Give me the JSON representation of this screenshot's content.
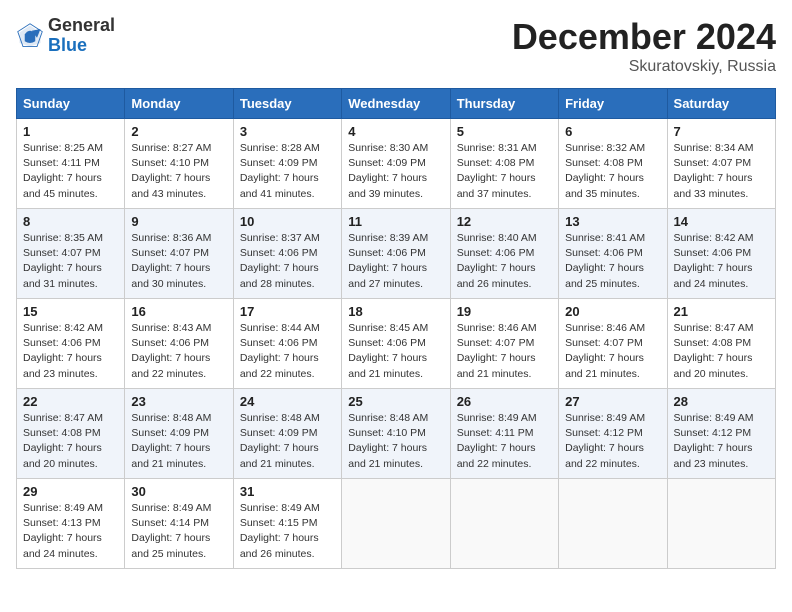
{
  "header": {
    "logo": {
      "line1": "General",
      "line2": "Blue"
    },
    "title": "December 2024",
    "subtitle": "Skuratovskiy, Russia"
  },
  "weekdays": [
    "Sunday",
    "Monday",
    "Tuesday",
    "Wednesday",
    "Thursday",
    "Friday",
    "Saturday"
  ],
  "weeks": [
    [
      {
        "day": "1",
        "detail": "Sunrise: 8:25 AM\nSunset: 4:11 PM\nDaylight: 7 hours\nand 45 minutes."
      },
      {
        "day": "2",
        "detail": "Sunrise: 8:27 AM\nSunset: 4:10 PM\nDaylight: 7 hours\nand 43 minutes."
      },
      {
        "day": "3",
        "detail": "Sunrise: 8:28 AM\nSunset: 4:09 PM\nDaylight: 7 hours\nand 41 minutes."
      },
      {
        "day": "4",
        "detail": "Sunrise: 8:30 AM\nSunset: 4:09 PM\nDaylight: 7 hours\nand 39 minutes."
      },
      {
        "day": "5",
        "detail": "Sunrise: 8:31 AM\nSunset: 4:08 PM\nDaylight: 7 hours\nand 37 minutes."
      },
      {
        "day": "6",
        "detail": "Sunrise: 8:32 AM\nSunset: 4:08 PM\nDaylight: 7 hours\nand 35 minutes."
      },
      {
        "day": "7",
        "detail": "Sunrise: 8:34 AM\nSunset: 4:07 PM\nDaylight: 7 hours\nand 33 minutes."
      }
    ],
    [
      {
        "day": "8",
        "detail": "Sunrise: 8:35 AM\nSunset: 4:07 PM\nDaylight: 7 hours\nand 31 minutes."
      },
      {
        "day": "9",
        "detail": "Sunrise: 8:36 AM\nSunset: 4:07 PM\nDaylight: 7 hours\nand 30 minutes."
      },
      {
        "day": "10",
        "detail": "Sunrise: 8:37 AM\nSunset: 4:06 PM\nDaylight: 7 hours\nand 28 minutes."
      },
      {
        "day": "11",
        "detail": "Sunrise: 8:39 AM\nSunset: 4:06 PM\nDaylight: 7 hours\nand 27 minutes."
      },
      {
        "day": "12",
        "detail": "Sunrise: 8:40 AM\nSunset: 4:06 PM\nDaylight: 7 hours\nand 26 minutes."
      },
      {
        "day": "13",
        "detail": "Sunrise: 8:41 AM\nSunset: 4:06 PM\nDaylight: 7 hours\nand 25 minutes."
      },
      {
        "day": "14",
        "detail": "Sunrise: 8:42 AM\nSunset: 4:06 PM\nDaylight: 7 hours\nand 24 minutes."
      }
    ],
    [
      {
        "day": "15",
        "detail": "Sunrise: 8:42 AM\nSunset: 4:06 PM\nDaylight: 7 hours\nand 23 minutes."
      },
      {
        "day": "16",
        "detail": "Sunrise: 8:43 AM\nSunset: 4:06 PM\nDaylight: 7 hours\nand 22 minutes."
      },
      {
        "day": "17",
        "detail": "Sunrise: 8:44 AM\nSunset: 4:06 PM\nDaylight: 7 hours\nand 22 minutes."
      },
      {
        "day": "18",
        "detail": "Sunrise: 8:45 AM\nSunset: 4:06 PM\nDaylight: 7 hours\nand 21 minutes."
      },
      {
        "day": "19",
        "detail": "Sunrise: 8:46 AM\nSunset: 4:07 PM\nDaylight: 7 hours\nand 21 minutes."
      },
      {
        "day": "20",
        "detail": "Sunrise: 8:46 AM\nSunset: 4:07 PM\nDaylight: 7 hours\nand 21 minutes."
      },
      {
        "day": "21",
        "detail": "Sunrise: 8:47 AM\nSunset: 4:08 PM\nDaylight: 7 hours\nand 20 minutes."
      }
    ],
    [
      {
        "day": "22",
        "detail": "Sunrise: 8:47 AM\nSunset: 4:08 PM\nDaylight: 7 hours\nand 20 minutes."
      },
      {
        "day": "23",
        "detail": "Sunrise: 8:48 AM\nSunset: 4:09 PM\nDaylight: 7 hours\nand 21 minutes."
      },
      {
        "day": "24",
        "detail": "Sunrise: 8:48 AM\nSunset: 4:09 PM\nDaylight: 7 hours\nand 21 minutes."
      },
      {
        "day": "25",
        "detail": "Sunrise: 8:48 AM\nSunset: 4:10 PM\nDaylight: 7 hours\nand 21 minutes."
      },
      {
        "day": "26",
        "detail": "Sunrise: 8:49 AM\nSunset: 4:11 PM\nDaylight: 7 hours\nand 22 minutes."
      },
      {
        "day": "27",
        "detail": "Sunrise: 8:49 AM\nSunset: 4:12 PM\nDaylight: 7 hours\nand 22 minutes."
      },
      {
        "day": "28",
        "detail": "Sunrise: 8:49 AM\nSunset: 4:12 PM\nDaylight: 7 hours\nand 23 minutes."
      }
    ],
    [
      {
        "day": "29",
        "detail": "Sunrise: 8:49 AM\nSunset: 4:13 PM\nDaylight: 7 hours\nand 24 minutes."
      },
      {
        "day": "30",
        "detail": "Sunrise: 8:49 AM\nSunset: 4:14 PM\nDaylight: 7 hours\nand 25 minutes."
      },
      {
        "day": "31",
        "detail": "Sunrise: 8:49 AM\nSunset: 4:15 PM\nDaylight: 7 hours\nand 26 minutes."
      },
      null,
      null,
      null,
      null
    ]
  ]
}
